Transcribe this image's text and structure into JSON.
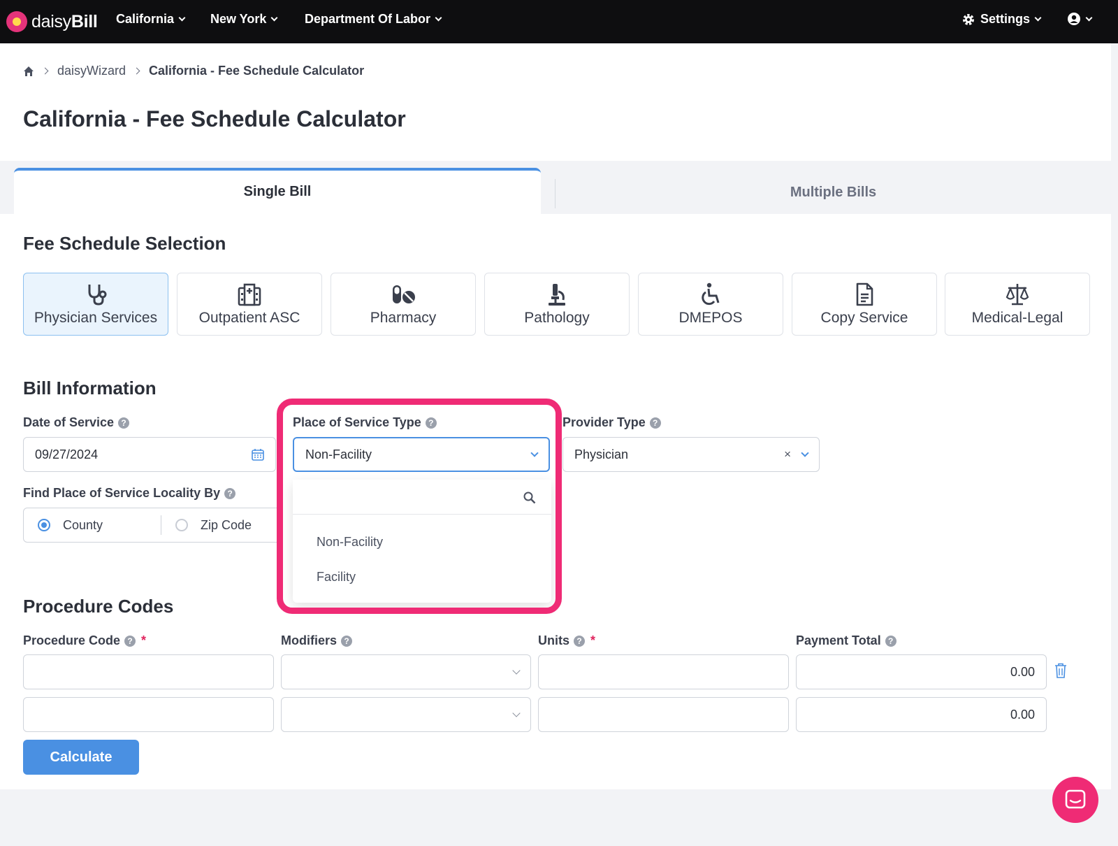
{
  "topbar": {
    "logo_text_light": "daisy",
    "logo_text_bold": "Bill",
    "nav": [
      "California",
      "New York",
      "Department Of Labor"
    ],
    "settings_label": "Settings"
  },
  "breadcrumb": {
    "item1": "daisyWizard",
    "current": "California - Fee Schedule Calculator"
  },
  "page_title": "California - Fee Schedule Calculator",
  "tabs": {
    "single": "Single Bill",
    "multiple": "Multiple Bills"
  },
  "fee_schedule": {
    "title": "Fee Schedule Selection",
    "cards": [
      {
        "label": "Physician Services",
        "icon": "stethoscope-icon"
      },
      {
        "label": "Outpatient ASC",
        "icon": "hospital-icon"
      },
      {
        "label": "Pharmacy",
        "icon": "pills-icon"
      },
      {
        "label": "Pathology",
        "icon": "microscope-icon"
      },
      {
        "label": "DMEPOS",
        "icon": "wheelchair-icon"
      },
      {
        "label": "Copy Service",
        "icon": "document-icon"
      },
      {
        "label": "Medical-Legal",
        "icon": "scales-icon"
      }
    ],
    "selected": "Physician Services"
  },
  "bill_info": {
    "title": "Bill Information",
    "date_label": "Date of Service",
    "date_value": "09/27/2024",
    "pos_type_label": "Place of Service Type",
    "pos_type_value": "Non-Facility",
    "provider_label": "Provider Type",
    "provider_value": "Physician",
    "locality_label": "Find Place of Service Locality By",
    "locality_options": [
      "County",
      "Zip Code"
    ],
    "locality_selected": "County",
    "pos_options": [
      "Non-Facility",
      "Facility"
    ]
  },
  "procedure": {
    "title": "Procedure Codes",
    "col_code": "Procedure Code",
    "col_modifiers": "Modifiers",
    "col_units": "Units",
    "col_total": "Payment Total",
    "required_mark": "*",
    "rows": [
      {
        "total": "0.00"
      },
      {
        "total": "0.00"
      }
    ]
  },
  "calculate_label": "Calculate",
  "colors": {
    "accent": "#4a90e2",
    "highlight": "#ef2b75",
    "topbar": "#0e0e10"
  }
}
